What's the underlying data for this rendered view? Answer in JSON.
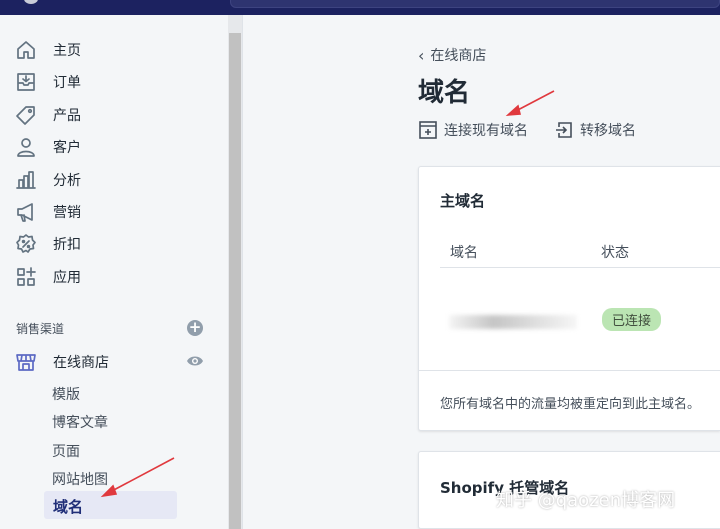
{
  "sidebar": {
    "items": [
      {
        "label": "主页",
        "icon": "home-icon"
      },
      {
        "label": "订单",
        "icon": "orders-icon"
      },
      {
        "label": "产品",
        "icon": "tag-icon"
      },
      {
        "label": "客户",
        "icon": "person-icon"
      },
      {
        "label": "分析",
        "icon": "bar-chart-icon"
      },
      {
        "label": "营销",
        "icon": "megaphone-icon"
      },
      {
        "label": "折扣",
        "icon": "discount-icon"
      },
      {
        "label": "应用",
        "icon": "apps-icon"
      }
    ],
    "sales_channels": {
      "title": "销售渠道",
      "online_store": {
        "label": "在线商店",
        "icon": "store-icon",
        "sub_items": [
          "模版",
          "博客文章",
          "页面",
          "网站地图",
          "域名"
        ],
        "active_item": "域名"
      }
    }
  },
  "main": {
    "breadcrumb": "在线商店",
    "title": "域名",
    "actions": [
      {
        "label": "连接现有域名",
        "icon": "connect-domain-icon"
      },
      {
        "label": "转移域名",
        "icon": "transfer-domain-icon"
      }
    ],
    "primary_domain_card": {
      "title": "主域名",
      "columns": [
        "域名",
        "状态"
      ],
      "row": {
        "status": "已连接"
      },
      "note": "您所有域名中的流量均被重定向到此主域名。"
    },
    "managed_card": {
      "title": "Shopify 托管域名"
    }
  },
  "watermark": "知乎 @qaozen博客网",
  "colors": {
    "topbar": "#1c2260",
    "active_nav_bg": "#e6e8f5",
    "active_nav_text": "#202e78",
    "badge_bg": "#bbe5b3",
    "annotation_arrow": "#e0393e"
  }
}
